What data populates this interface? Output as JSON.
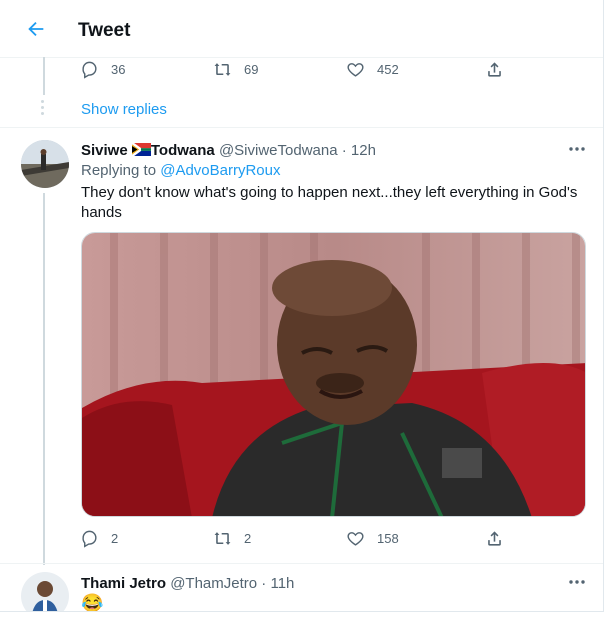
{
  "header": {
    "title": "Tweet"
  },
  "prev_tweet": {
    "actions": {
      "replies": "36",
      "retweets": "69",
      "likes": "452"
    }
  },
  "show_replies": "Show replies",
  "tweet": {
    "name": "Siviwe",
    "name_suffix": "Todwana",
    "flag_icon": "south-africa-flag-emoji",
    "handle": "@SiviweTodwana",
    "time": "12h",
    "replying_prefix": "Replying to",
    "replying_to": "@AdvoBarryRoux",
    "text": "They don't know what's going to happen next...they left everything in God's hands",
    "actions": {
      "replies": "2",
      "retweets": "2",
      "likes": "158"
    }
  },
  "reply": {
    "name": "Thami Jetro",
    "handle": "@ThamJetro",
    "time": "11h",
    "text": "😂"
  },
  "colors": {
    "accent": "#1d9bf0",
    "secondary_text": "#536471",
    "border": "#eff3f4",
    "thread": "#cfd9de"
  }
}
